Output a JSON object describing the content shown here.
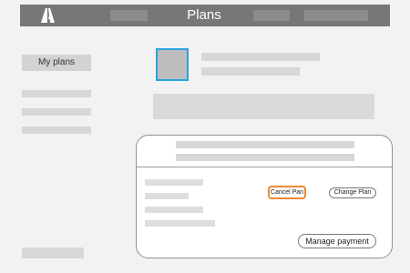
{
  "header": {
    "title": "Plans",
    "logo_icon": "adobe-logo-icon"
  },
  "sidebar": {
    "active_item_label": "My plans"
  },
  "plan_card": {
    "buttons": {
      "cancel_label": "Cancel Pan",
      "change_label": "Change Plan",
      "manage_label": "Manage payment"
    }
  },
  "colors": {
    "topbar": "#777777",
    "avatar_border": "#2aa3dd",
    "cancel_highlight": "#ef8a2f"
  }
}
